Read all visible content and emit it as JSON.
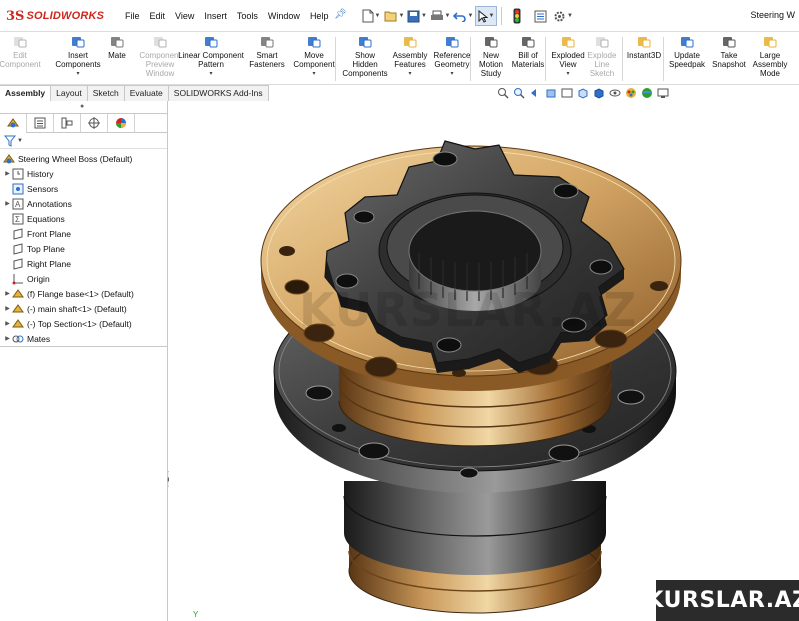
{
  "app": {
    "logo_ds": "3S",
    "logo_word": "SOLIDWORKS",
    "window_title": "Steering W"
  },
  "menu": [
    "File",
    "Edit",
    "View",
    "Insert",
    "Tools",
    "Window",
    "Help"
  ],
  "quick_access": [
    "new-doc-icon",
    "open-icon",
    "save-icon",
    "print-icon",
    "undo-icon",
    "select-icon",
    "rebuild-icon",
    "file-properties-icon",
    "options-icon"
  ],
  "commands": [
    {
      "label": "Edit\nComponent",
      "enabled": false,
      "icon": "edit-component-icon",
      "has_arrow": false
    },
    {
      "label": "Insert\nComponents",
      "enabled": true,
      "icon": "insert-components-icon",
      "has_arrow": true
    },
    {
      "label": "Mate",
      "enabled": true,
      "icon": "mate-icon",
      "has_arrow": false
    },
    {
      "label": "Component\nPreview\nWindow",
      "enabled": false,
      "icon": "component-preview-icon",
      "has_arrow": false
    },
    {
      "label": "Linear Component\nPattern",
      "enabled": true,
      "icon": "linear-pattern-icon",
      "has_arrow": true
    },
    {
      "label": "Smart\nFasteners",
      "enabled": true,
      "icon": "smart-fasteners-icon",
      "has_arrow": false
    },
    {
      "label": "Move\nComponent",
      "enabled": true,
      "icon": "move-component-icon",
      "has_arrow": true
    },
    {
      "label": "Show\nHidden\nComponents",
      "enabled": true,
      "icon": "show-hidden-icon",
      "has_arrow": false
    },
    {
      "label": "Assembly\nFeatures",
      "enabled": true,
      "icon": "assembly-features-icon",
      "has_arrow": true
    },
    {
      "label": "Reference\nGeometry",
      "enabled": true,
      "icon": "reference-geometry-icon",
      "has_arrow": true
    },
    {
      "label": "New\nMotion\nStudy",
      "enabled": true,
      "icon": "motion-study-icon",
      "has_arrow": false
    },
    {
      "label": "Bill of\nMaterials",
      "enabled": true,
      "icon": "bom-icon",
      "has_arrow": false
    },
    {
      "label": "Exploded\nView",
      "enabled": true,
      "icon": "exploded-view-icon",
      "has_arrow": true
    },
    {
      "label": "Explode\nLine\nSketch",
      "enabled": false,
      "icon": "explode-line-icon",
      "has_arrow": false
    },
    {
      "label": "Instant3D",
      "enabled": true,
      "icon": "instant3d-icon",
      "has_arrow": false
    },
    {
      "label": "Update\nSpeedpak",
      "enabled": true,
      "icon": "speedpak-icon",
      "has_arrow": false
    },
    {
      "label": "Take\nSnapshot",
      "enabled": true,
      "icon": "snapshot-icon",
      "has_arrow": false
    },
    {
      "label": "Large\nAssembly\nMode",
      "enabled": true,
      "icon": "large-assembly-icon",
      "has_arrow": false
    }
  ],
  "tabs": [
    {
      "label": "Assembly",
      "active": true
    },
    {
      "label": "Layout",
      "active": false
    },
    {
      "label": "Sketch",
      "active": false
    },
    {
      "label": "Evaluate",
      "active": false
    },
    {
      "label": "SOLIDWORKS Add-Ins",
      "active": false
    }
  ],
  "tree": {
    "root": "Steering Wheel Boss  (Default)",
    "items": [
      {
        "label": "History",
        "icon": "history-icon",
        "expandable": true
      },
      {
        "label": "Sensors",
        "icon": "sensors-icon",
        "expandable": false
      },
      {
        "label": "Annotations",
        "icon": "annotations-icon",
        "expandable": true
      },
      {
        "label": "Equations",
        "icon": "equations-icon",
        "expandable": false
      },
      {
        "label": "Front Plane",
        "icon": "plane-icon",
        "expandable": false
      },
      {
        "label": "Top Plane",
        "icon": "plane-icon",
        "expandable": false
      },
      {
        "label": "Right Plane",
        "icon": "plane-icon",
        "expandable": false
      },
      {
        "label": "Origin",
        "icon": "origin-icon",
        "expandable": false
      },
      {
        "label": "(f) Flange base<1> (Default)",
        "icon": "part-icon",
        "expandable": true
      },
      {
        "label": "(-) main shaft<1> (Default)",
        "icon": "part-icon",
        "expandable": true
      },
      {
        "label": "(-) Top Section<1> (Default)",
        "icon": "part-icon",
        "expandable": true
      },
      {
        "label": "Mates",
        "icon": "mates-icon",
        "expandable": true
      }
    ]
  },
  "viewport": {
    "triad_label": "Y"
  },
  "watermark": {
    "center": "KURSLAR.AZ",
    "badge": "KURSLAR.AZ"
  },
  "colors": {
    "brand_red": "#d0271d",
    "bronze": "#c8984f",
    "dark_steel": "#3a3a3a"
  }
}
